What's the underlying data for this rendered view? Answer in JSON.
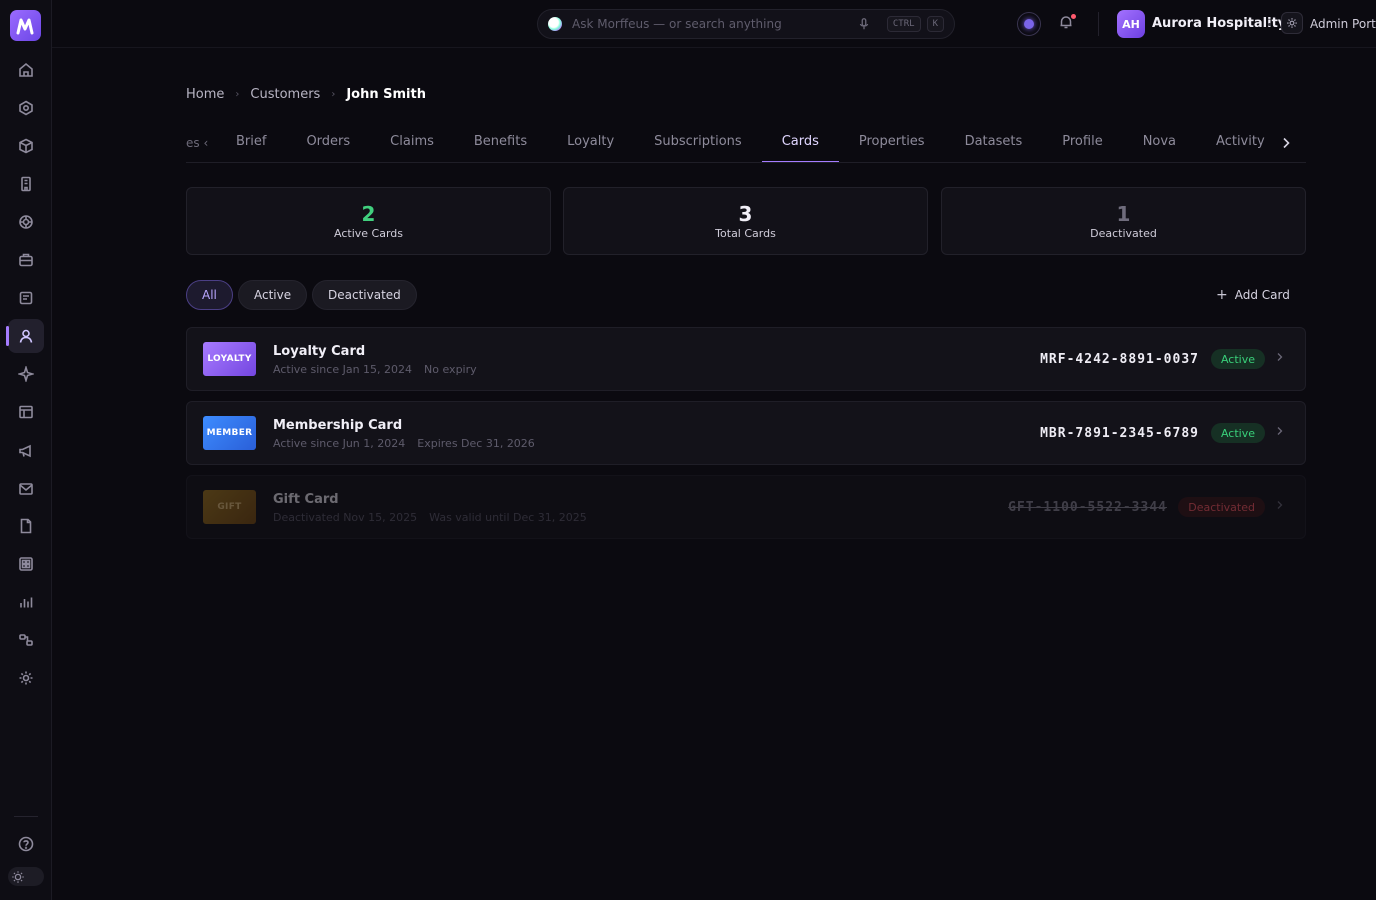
{
  "topbar": {
    "search_placeholder": "Ask Morffeus — or search anything",
    "shortcut_keys": [
      "CTRL",
      "K"
    ],
    "org_initials": "AH",
    "org_name": "Aurora Hospitality",
    "portal_name": "Admin Portal"
  },
  "breadcrumb": [
    "Home",
    "Customers",
    "John Smith"
  ],
  "tabs": {
    "partial_label": "es",
    "items": [
      "Brief",
      "Orders",
      "Claims",
      "Benefits",
      "Loyalty",
      "Subscriptions",
      "Cards",
      "Properties",
      "Datasets",
      "Profile",
      "Nova",
      "Activity"
    ],
    "active": "Cards"
  },
  "stats": [
    {
      "value": "2",
      "label": "Active Cards",
      "color": "#41d07e"
    },
    {
      "value": "3",
      "label": "Total Cards",
      "color": "#f1eff7"
    },
    {
      "value": "1",
      "label": "Deactivated",
      "color": "#6f6c7c"
    }
  ],
  "filters": [
    "All",
    "Active",
    "Deactivated"
  ],
  "active_filter": "All",
  "add_card_label": "Add Card",
  "cards": [
    {
      "thumb": "LOYALTY",
      "title": "Loyalty Card",
      "sub1": "Active since Jan 15, 2024",
      "sub2": "No expiry",
      "number": "MRF-4242-8891-0037",
      "status": "Active"
    },
    {
      "thumb": "MEMBER",
      "title": "Membership Card",
      "sub1": "Active since Jun 1, 2024",
      "sub2": "Expires Dec 31, 2026",
      "number": "MBR-7891-2345-6789",
      "status": "Active"
    },
    {
      "thumb": "GIFT",
      "title": "Gift Card",
      "sub1": "Deactivated Nov 15, 2025",
      "sub2": "Was valid until Dec 31, 2025",
      "number": "GFT-1100-5522-3344",
      "status": "Deactivated"
    }
  ],
  "colors": {
    "accent": "#a57cff",
    "active": "#39d07a",
    "deactivated": "#ff5a63",
    "background": "#0b0a10"
  },
  "sidebar_icons": [
    "home-icon",
    "hexagon-icon",
    "cube-icon",
    "building-icon",
    "globe-icon",
    "briefcase-icon",
    "document-list-icon",
    "user-icon",
    "sparkle-icon",
    "table-icon",
    "megaphone-icon",
    "mail-icon",
    "file-icon",
    "grid-icon",
    "bar-chart-icon",
    "flow-icon",
    "settings-icon",
    "help-icon",
    "sun-icon"
  ]
}
